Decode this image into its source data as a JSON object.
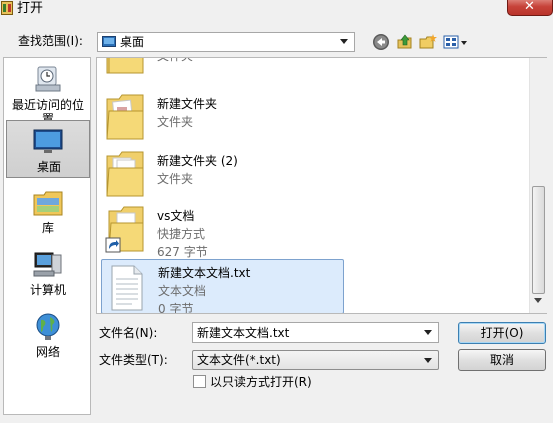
{
  "window": {
    "title": "打开",
    "close_symbol": "✕"
  },
  "toolbar": {
    "look_in_label": "查找范围(I):",
    "look_in_value": "桌面"
  },
  "places": [
    {
      "label": "最近访问的位置"
    },
    {
      "label": "桌面"
    },
    {
      "label": "库"
    },
    {
      "label": "计算机"
    },
    {
      "label": "网络"
    }
  ],
  "files": [
    {
      "name": "",
      "type": "文件夹",
      "size": ""
    },
    {
      "name": "新建文件夹",
      "type": "文件夹",
      "size": ""
    },
    {
      "name": "新建文件夹 (2)",
      "type": "文件夹",
      "size": ""
    },
    {
      "name": "vs文档",
      "type": "快捷方式",
      "size": "627 字节"
    },
    {
      "name": "新建文本文档.txt",
      "type": "文本文档",
      "size": "0 字节"
    }
  ],
  "form": {
    "filename_label": "文件名(N):",
    "filename_value": "新建文本文档.txt",
    "filetype_label": "文件类型(T):",
    "filetype_value": "文本文件(*.txt)",
    "readonly_label": "以只读方式打开(R)",
    "readonly_checked": false
  },
  "buttons": {
    "open": "打开(O)",
    "cancel": "取消"
  },
  "colors": {
    "selection_bg": "#dcebfc",
    "selection_border": "#7da2ce",
    "secondary_text": "#6d6d6d",
    "close_button": "#c7433a"
  }
}
